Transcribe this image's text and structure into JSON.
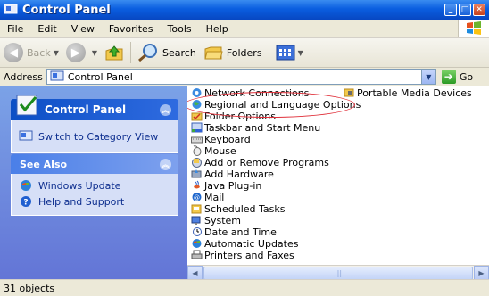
{
  "window": {
    "title": "Control Panel"
  },
  "menu": [
    "File",
    "Edit",
    "View",
    "Favorites",
    "Tools",
    "Help"
  ],
  "toolbar": {
    "back_label": "Back",
    "search_label": "Search",
    "folders_label": "Folders"
  },
  "address": {
    "label": "Address",
    "value": "Control Panel",
    "go_label": "Go"
  },
  "taskpane": {
    "panel_title": "Control Panel",
    "switch_link": "Switch to Category View",
    "see_also_title": "See Also",
    "see_also_links": [
      "Windows Update",
      "Help and Support"
    ]
  },
  "items": [
    "Network Connections",
    "Regional and Language Options",
    "Folder Options",
    "Taskbar and Start Menu",
    "Keyboard",
    "Mouse",
    "Add or Remove Programs",
    "Add Hardware",
    "Java Plug-in",
    "Mail",
    "Scheduled Tasks",
    "System",
    "Date and Time",
    "Automatic Updates",
    "Printers and Faxes"
  ],
  "items_col2": [
    "Portable Media Devices"
  ],
  "highlighted_item": "Regional and Language Options",
  "status": {
    "text": "31 objects"
  },
  "colors": {
    "title_bar": "#0a5ee0",
    "task_pane": "#6e8fe0",
    "highlight_ellipse": "#e0303a"
  }
}
